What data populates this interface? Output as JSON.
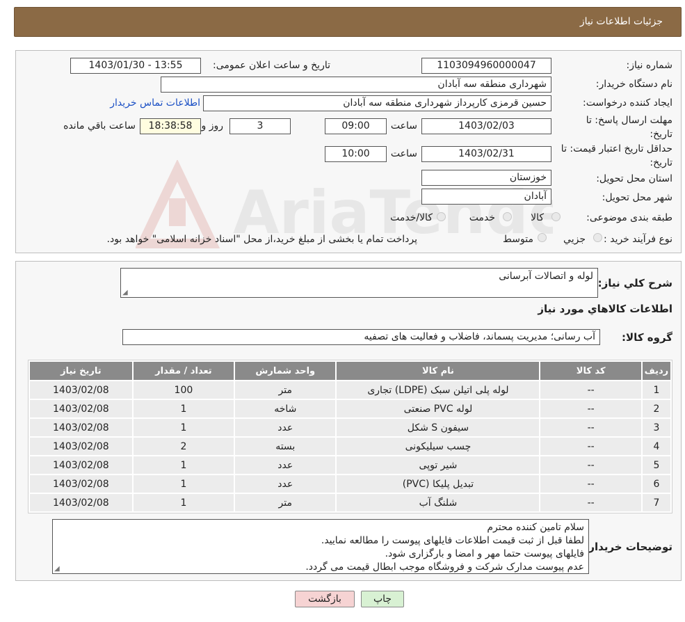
{
  "header": {
    "title": "جزئیات اطلاعات نیاز"
  },
  "info": {
    "need_number_label": "شماره نیاز:",
    "need_number": "1103094960000047",
    "announce_label": "تاریخ و ساعت اعلان عمومی:",
    "announce_value": "1403/01/30 - 13:55",
    "buyer_org_label": "نام دستگاه خریدار:",
    "buyer_org": "شهرداری منطقه سه آبادان",
    "creator_label": "ایجاد کننده درخواست:",
    "creator": "حسین قرمزی کارپرداز شهرداری منطقه سه آبادان",
    "contact_link": "اطلاعات تماس خریدار",
    "deadline_label_line1": "مهلت ارسال پاسخ: تا",
    "deadline_label_line2": "تاریخ:",
    "deadline_date": "1403/02/03",
    "time_label": "ساعت",
    "deadline_time": "09:00",
    "days_value": "3",
    "days_label": "روز و",
    "remaining_time": "18:38:58",
    "remaining_label": "ساعت باقي مانده",
    "validity_label_line1": "حداقل تاریخ اعتبار قیمت: تا",
    "validity_label_line2": "تاریخ:",
    "validity_date": "1403/02/31",
    "validity_time": "10:00",
    "province_label": "استان محل تحویل:",
    "province": "خوزستان",
    "city_label": "شهر محل تحویل:",
    "city": "آبادان",
    "category_label": "طبقه بندی موضوعی:",
    "category_options": [
      "کالا",
      "خدمت",
      "کالا/خدمت"
    ],
    "process_label": "نوع فرآیند خرید :",
    "process_options": [
      "جزيي",
      "متوسط"
    ],
    "process_note": "پرداخت تمام یا بخشی از مبلغ خرید،از محل \"اسناد خزانه اسلامی\" خواهد بود."
  },
  "summary": {
    "general_desc_label": "شرح كلي نياز:",
    "general_desc": "لوله و اتصالات آبرسانی",
    "items_info_title": "اطلاعات كالاهاي مورد نياز",
    "group_label": "گروه كالا:",
    "group_value": "آب رسانی؛ مدیریت پسماند، فاضلاب و فعالیت های تصفیه"
  },
  "table": {
    "headers": [
      "رديف",
      "كد كالا",
      "نام كالا",
      "واحد شمارش",
      "تعداد / مقدار",
      "تاريخ نياز"
    ],
    "rows": [
      [
        "1",
        "--",
        "لوله پلی اتیلن سبک (LDPE) تجاری",
        "متر",
        "100",
        "1403/02/08"
      ],
      [
        "2",
        "--",
        "لوله PVC صنعتی",
        "شاخه",
        "1",
        "1403/02/08"
      ],
      [
        "3",
        "--",
        "سیفون S شکل",
        "عدد",
        "1",
        "1403/02/08"
      ],
      [
        "4",
        "--",
        "چسب سیلیکونی",
        "بسته",
        "2",
        "1403/02/08"
      ],
      [
        "5",
        "--",
        "شیر توپی",
        "عدد",
        "1",
        "1403/02/08"
      ],
      [
        "6",
        "--",
        "تبدیل پلیکا (PVC)",
        "عدد",
        "1",
        "1403/02/08"
      ],
      [
        "7",
        "--",
        "شلنگ آب",
        "متر",
        "1",
        "1403/02/08"
      ]
    ]
  },
  "buyer_notes": {
    "label": "توضيحات خريدار:",
    "lines": [
      "سلام تامین کننده محترم",
      "لطفا قبل از ثبت قیمت اطلاعات فایلهای پیوست را مطالعه نمایید.",
      "فایلهای پیوست حتما مهر و امضا و بارگزاری شود.",
      "عدم پیوست مدارک شرکت و فروشگاه موجب ابطال قیمت می گردد."
    ]
  },
  "buttons": {
    "print": "چاپ",
    "back": "بازگشت"
  },
  "watermark": {
    "text": "AriaTender.neT"
  },
  "colors": {
    "header_bg": "#8b6a45",
    "table_header_bg": "#8a8a8a",
    "link": "#1a4fc4",
    "back_button_bg": "#f6d3d3",
    "print_button_bg": "#d8f1d3"
  }
}
